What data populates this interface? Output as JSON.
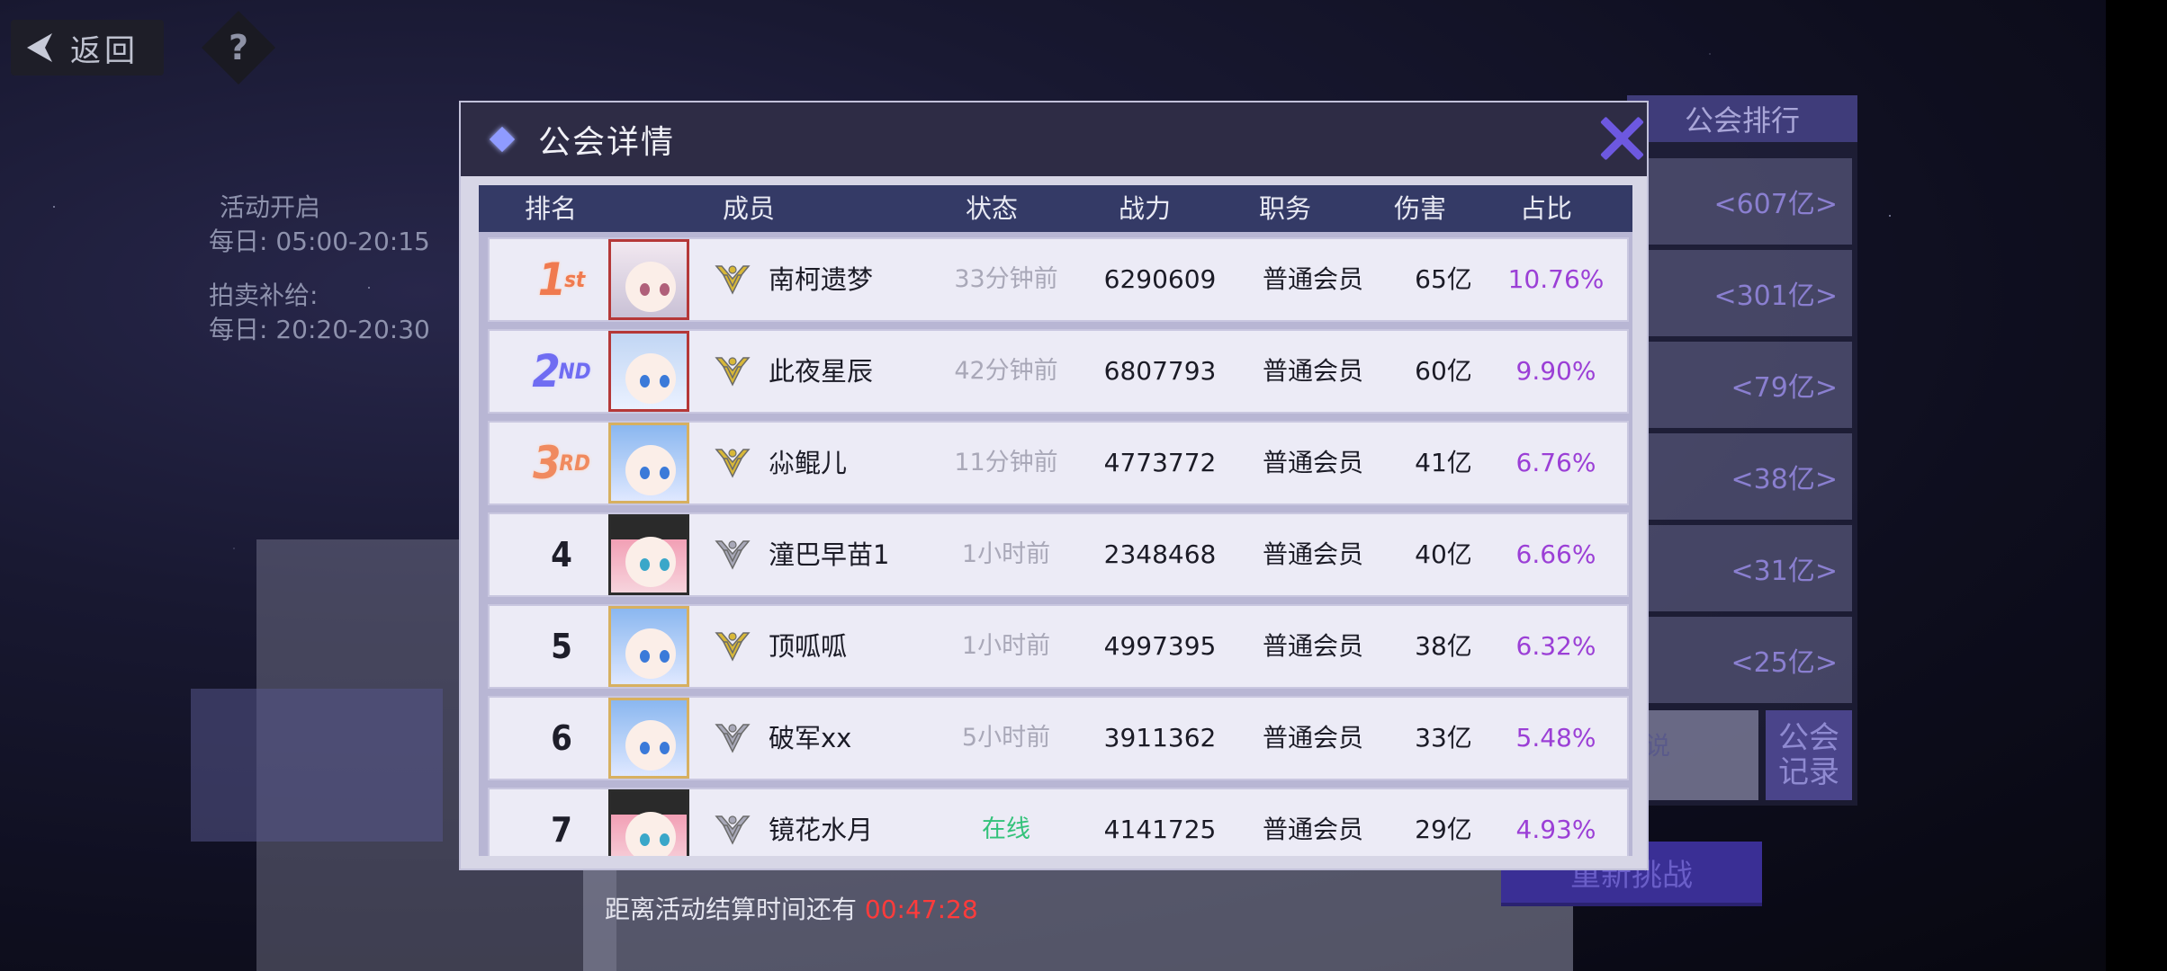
{
  "nav": {
    "back_label": "返回",
    "help_label": "?"
  },
  "activity": {
    "open_label": "活动开启",
    "open_time": "每日: 05:00-20:15",
    "auction_label": "拍卖补给:",
    "auction_time": "每日: 20:20-20:30"
  },
  "ranking_panel": {
    "title": "公会排行",
    "values": [
      "<607亿>",
      "<301亿>",
      "<79亿>",
      "<38亿>",
      "<31亿>",
      "<25亿>"
    ],
    "info_box_text": "说",
    "record_button": "公会\n记录"
  },
  "retry_button": "重新挑战",
  "countdown": {
    "label": "距离活动结算时间还有",
    "time": "00:47:28"
  },
  "modal": {
    "title": "公会详情",
    "columns": [
      "排名",
      "成员",
      "状态",
      "战力",
      "职务",
      "伤害",
      "占比"
    ],
    "rows": [
      {
        "rank": "1",
        "rank_suffix": "st",
        "name": "南柯遗梦",
        "status": "33分钟前",
        "power": "6290609",
        "duty": "普通会员",
        "damage": "65亿",
        "ratio": "10.76%",
        "badge": "gold"
      },
      {
        "rank": "2",
        "rank_suffix": "ND",
        "name": "此夜星辰",
        "status": "42分钟前",
        "power": "6807793",
        "duty": "普通会员",
        "damage": "60亿",
        "ratio": "9.90%",
        "badge": "gold"
      },
      {
        "rank": "3",
        "rank_suffix": "RD",
        "name": "尛鲲儿",
        "status": "11分钟前",
        "power": "4773772",
        "duty": "普通会员",
        "damage": "41亿",
        "ratio": "6.76%",
        "badge": "gold"
      },
      {
        "rank": "4",
        "name": "潼巴早苗1",
        "status": "1小时前",
        "power": "2348468",
        "duty": "普通会员",
        "damage": "40亿",
        "ratio": "6.66%",
        "badge": "silver"
      },
      {
        "rank": "5",
        "name": "顶呱呱",
        "status": "1小时前",
        "power": "4997395",
        "duty": "普通会员",
        "damage": "38亿",
        "ratio": "6.32%",
        "badge": "gold"
      },
      {
        "rank": "6",
        "name": "破军xx",
        "status": "5小时前",
        "power": "3911362",
        "duty": "普通会员",
        "damage": "33亿",
        "ratio": "5.48%",
        "badge": "silver"
      },
      {
        "rank": "7",
        "name": "镜花水月",
        "status": "在线",
        "power": "4141725",
        "duty": "普通会员",
        "damage": "29亿",
        "ratio": "4.93%",
        "badge": "silver"
      }
    ]
  },
  "colors": {
    "accent": "#6d58e0",
    "ratio": "#9b3fd6",
    "online": "#33c27a",
    "countdown": "#ff3b3b"
  }
}
